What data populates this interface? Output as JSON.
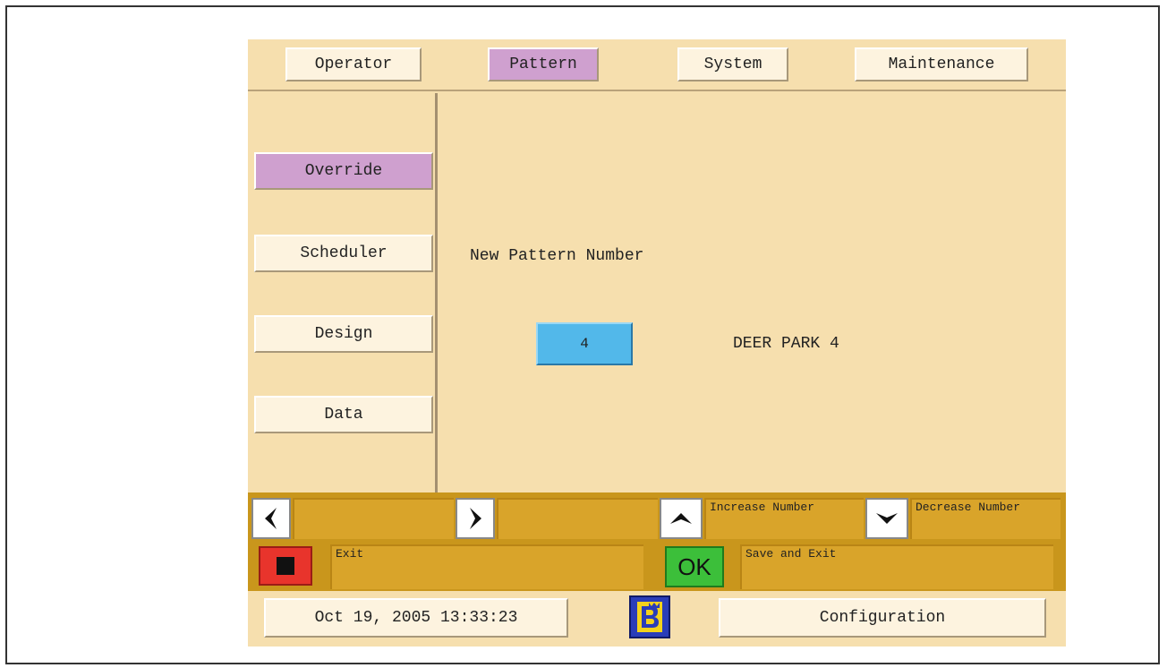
{
  "tabs": [
    {
      "label": "Operator"
    },
    {
      "label": "Pattern"
    },
    {
      "label": "System"
    },
    {
      "label": "Maintenance"
    }
  ],
  "sidebar": {
    "items": [
      {
        "label": "Override"
      },
      {
        "label": "Scheduler"
      },
      {
        "label": "Design"
      },
      {
        "label": "Data"
      }
    ]
  },
  "main": {
    "prompt": "New Pattern Number",
    "pattern_number": "4",
    "pattern_name": "DEER PARK 4"
  },
  "softkeys": {
    "increase_label": "Increase Number",
    "decrease_label": "Decrease Number",
    "exit_label": "Exit",
    "ok_label": "OK",
    "save_exit_label": "Save and Exit"
  },
  "status": {
    "datetime": "Oct 19, 2005 13:33:23",
    "configuration_label": "Configuration"
  },
  "colors": {
    "background": "#f6dfae",
    "active_tab": "#cfa0cf",
    "number_field": "#52b8ea",
    "softkey_bar": "#d9a42a",
    "exit_button": "#e8342c",
    "ok_button": "#3cbf3a"
  },
  "icons": {
    "left": "arrow-left-icon",
    "right": "arrow-right-icon",
    "up": "arrow-up-icon",
    "down": "arrow-down-icon",
    "stop": "stop-icon",
    "logo": "crown-b-logo-icon"
  }
}
